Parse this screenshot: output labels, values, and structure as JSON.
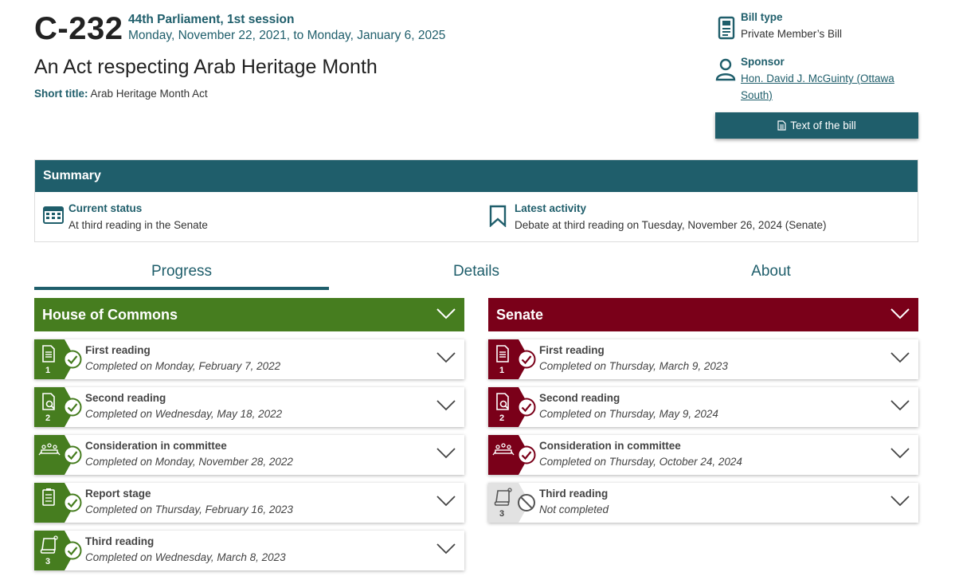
{
  "bill": {
    "number": "C-232",
    "session": "44th Parliament, 1st session",
    "dates": "Monday, November 22, 2021, to Monday, January 6, 2025",
    "title": "An Act respecting Arab Heritage Month",
    "short_title_label": "Short title:",
    "short_title": "Arab Heritage Month Act"
  },
  "meta": {
    "bill_type_label": "Bill type",
    "bill_type": "Private Member’s Bill",
    "sponsor_label": "Sponsor",
    "sponsor_line1": "Hon. David J. McGuinty (Ottawa",
    "sponsor_line2": "South)",
    "text_button": "Text of the bill"
  },
  "summary": {
    "heading": "Summary",
    "current_status_label": "Current status",
    "current_status": "At third reading in the Senate",
    "latest_activity_label": "Latest activity",
    "latest_activity": "Debate at third reading on Tuesday, November 26, 2024 (Senate)"
  },
  "tabs": [
    {
      "label": "Progress",
      "active": true
    },
    {
      "label": "Details",
      "active": false
    },
    {
      "label": "About",
      "active": false
    }
  ],
  "commons": {
    "title": "House of Commons",
    "color": "#467d1f",
    "stages": [
      {
        "name": "First reading",
        "date": "Completed on Monday, February 7, 2022",
        "number": "1"
      },
      {
        "name": "Second reading",
        "date": "Completed on Wednesday, May 18, 2022",
        "number": "2"
      },
      {
        "name": "Consideration in committee",
        "date": "Completed on Monday, November 28, 2022",
        "number": ""
      },
      {
        "name": "Report stage",
        "date": "Completed on Thursday, February 16, 2023",
        "number": ""
      },
      {
        "name": "Third reading",
        "date": "Completed on Wednesday, March 8, 2023",
        "number": "3"
      }
    ]
  },
  "senate": {
    "title": "Senate",
    "color": "#7a0019",
    "stages": [
      {
        "name": "First reading",
        "date": "Completed on Thursday, March 9, 2023",
        "number": "1"
      },
      {
        "name": "Second reading",
        "date": "Completed on Thursday, May 9, 2024",
        "number": "2"
      },
      {
        "name": "Consideration in committee",
        "date": "Completed on Thursday, October 24, 2024",
        "number": ""
      },
      {
        "name": "Third reading",
        "date": "Not completed",
        "number": "3"
      }
    ]
  },
  "colors": {
    "teal": "#1f5e6b",
    "commons_green": "#467d1f",
    "senate_red": "#7a0019",
    "pending_gray": "#e2e2e2"
  }
}
